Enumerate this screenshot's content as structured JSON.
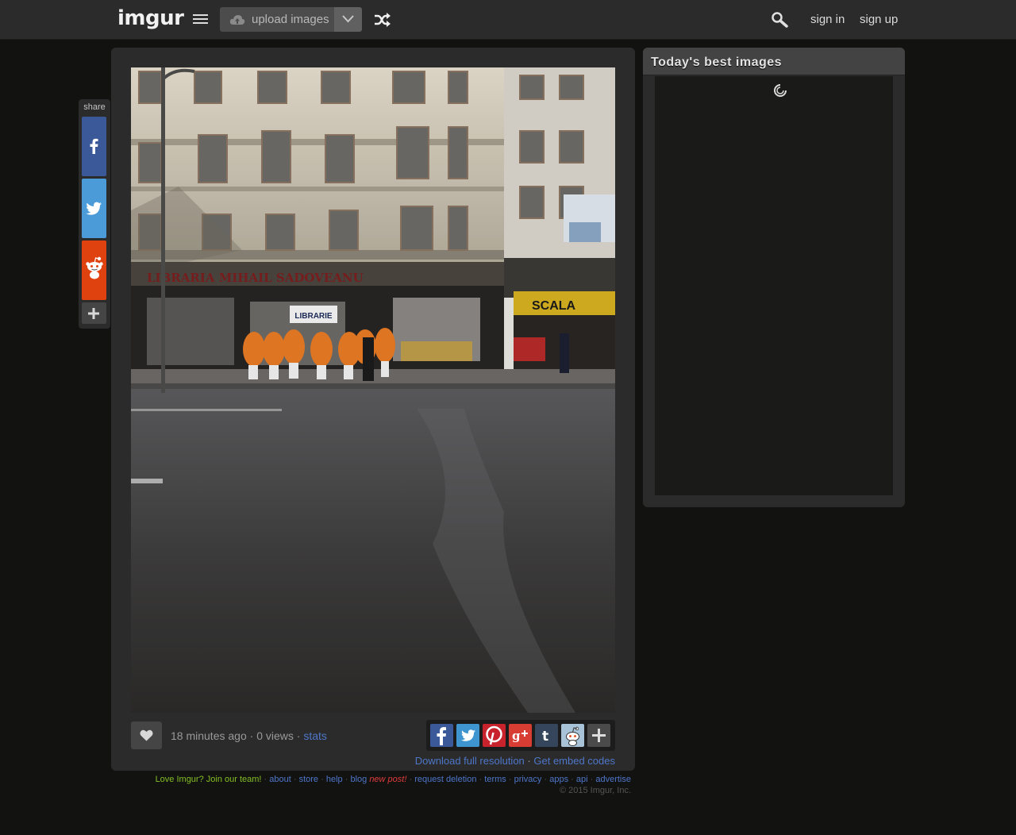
{
  "header": {
    "logo_text": "imgur",
    "upload_label": "upload images",
    "sign_in": "sign in",
    "sign_up": "sign up"
  },
  "share_rail": {
    "label": "share",
    "items": [
      {
        "name": "facebook",
        "color": "#3b5998"
      },
      {
        "name": "twitter",
        "color": "#4c9bd9"
      },
      {
        "name": "reddit",
        "color": "#e0420f"
      },
      {
        "name": "more",
        "color": "#454545"
      }
    ]
  },
  "photo": {
    "storefront_sign": "LIBRARIE",
    "cafe_sign": "SCALA"
  },
  "image_meta": {
    "time_ago": "18 minutes ago",
    "views": "0 views",
    "stats_label": "stats",
    "sep": "·"
  },
  "social_buttons": [
    {
      "name": "facebook",
      "glyph": "f",
      "color": "#3b5998"
    },
    {
      "name": "twitter",
      "glyph": "t",
      "color": "#3f95cf"
    },
    {
      "name": "pinterest",
      "glyph": "P",
      "color": "#c8232c"
    },
    {
      "name": "google-plus",
      "glyph": "g+",
      "color": "#d73d32"
    },
    {
      "name": "tumblr",
      "glyph": "t",
      "color": "#35465c"
    },
    {
      "name": "reddit",
      "glyph": "r",
      "color": "#a8c3d8"
    },
    {
      "name": "more",
      "glyph": "+",
      "color": "#4a4a4a"
    }
  ],
  "download": {
    "full_res": "Download full resolution",
    "embed": "Get embed codes"
  },
  "sidebar": {
    "title": "Today's best images"
  },
  "footer": {
    "join": "Love Imgur? Join our team!",
    "links": {
      "about": "about",
      "store": "store",
      "help": "help",
      "blog": "blog",
      "new_post": "new post!",
      "request_deletion": "request deletion",
      "terms": "terms",
      "privacy": "privacy",
      "apps": "apps",
      "api": "api",
      "advertise": "advertise"
    },
    "copyright": "© 2015 Imgur, Inc."
  }
}
